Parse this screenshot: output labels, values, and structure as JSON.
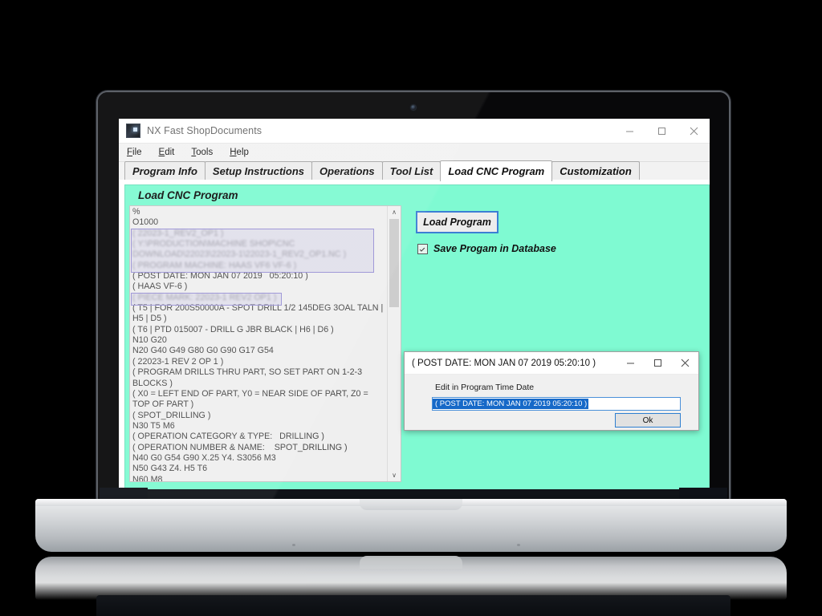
{
  "window": {
    "title": "NX Fast ShopDocuments",
    "icon": "app-icon",
    "controls": {
      "minimize": "—",
      "maximize": "□",
      "close": "✕"
    }
  },
  "menubar": [
    {
      "label": "File",
      "accel": "F"
    },
    {
      "label": "Edit",
      "accel": "E"
    },
    {
      "label": "Tools",
      "accel": "T"
    },
    {
      "label": "Help",
      "accel": "H"
    }
  ],
  "tabs": [
    {
      "label": "Program Info",
      "active": false
    },
    {
      "label": "Setup Instructions",
      "active": false
    },
    {
      "label": "Operations",
      "active": false
    },
    {
      "label": "Tool List",
      "active": false
    },
    {
      "label": "Load CNC Program",
      "active": true
    },
    {
      "label": "Customization",
      "active": false
    }
  ],
  "panel": {
    "title": "Load CNC Program",
    "bg_color": "#7ffad2"
  },
  "code_lines": [
    {
      "text": "%",
      "blurred": false
    },
    {
      "text": "O1000",
      "blurred": false
    },
    {
      "text": "( 22023-1_REV2_OP1 )",
      "blurred": true
    },
    {
      "text": "( Y:\\PRODUCTION\\MACHINE SHOP\\CNC DOWNLOAD\\22023\\22023-1\\22023-1_REV2_OP1.NC )",
      "blurred": true
    },
    {
      "text": "( PROGRAM MACHINE: HAAS VF6 VF-6 )",
      "blurred": true
    },
    {
      "text": "( POST DATE: MON JAN 07 2019   05:20:10 )",
      "blurred": false
    },
    {
      "text": "( HAAS VF-6 )",
      "blurred": false
    },
    {
      "text": "( PIECE MARK: 22023-1 REV2 OP1 )",
      "blurred": true
    },
    {
      "text": "( T5 | FOR 200S50000A - SPOT DRILL 1/2 145DEG 3OAL TALN | H5 | D5 )",
      "blurred": false
    },
    {
      "text": "( T6 | PTD 015007 - DRILL G JBR BLACK | H6 | D6 )",
      "blurred": false
    },
    {
      "text": "N10 G20",
      "blurred": false
    },
    {
      "text": "N20 G40 G49 G80 G0 G90 G17 G54",
      "blurred": false
    },
    {
      "text": "( 22023-1 REV 2 OP 1 )",
      "blurred": false
    },
    {
      "text": "( PROGRAM DRILLS THRU PART, SO SET PART ON 1-2-3 BLOCKS )",
      "blurred": false
    },
    {
      "text": "( X0 = LEFT END OF PART, Y0 = NEAR SIDE OF PART, Z0 = TOP OF PART )",
      "blurred": false
    },
    {
      "text": "( SPOT_DRILLING )",
      "blurred": false
    },
    {
      "text": "N30 T5 M6",
      "blurred": false
    },
    {
      "text": "( OPERATION CATEGORY & TYPE:   DRILLING )",
      "blurred": false
    },
    {
      "text": "( OPERATION NUMBER & NAME:    SPOT_DRILLING )",
      "blurred": false
    },
    {
      "text": "N40 G0 G54 G90 X.25 Y4. S3056 M3",
      "blurred": false
    },
    {
      "text": "N50 G43 Z4. H5 T6",
      "blurred": false
    },
    {
      "text": "N60 M8",
      "blurred": false
    }
  ],
  "scrollbar": {
    "up_arrow": "∧",
    "down_arrow": "∨"
  },
  "actions": {
    "load_program_label": "Load Program",
    "save_checkbox_label": "Save Progam in Database",
    "save_checkbox_checked": true
  },
  "dialog": {
    "title": "( POST DATE: MON JAN 07 2019   05:20:10 )",
    "label": "Edit in Program Time Date",
    "input_value": "( POST DATE: MON JAN 07 2019   05:20:10 )",
    "ok_label": "Ok",
    "controls": {
      "minimize": "—",
      "maximize": "□",
      "close": "✕"
    }
  }
}
